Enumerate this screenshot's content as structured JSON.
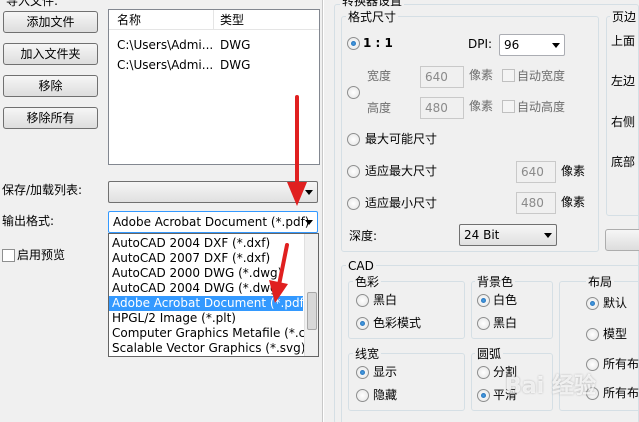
{
  "colors": {
    "accent": "#3399ff",
    "arrow": "#e02020",
    "focus": "#3399ff"
  },
  "left": {
    "import_group_title": "导入文件:",
    "buttons": [
      "添加文件",
      "加入文件夹",
      "移除",
      "移除所有"
    ],
    "file_list": {
      "columns": [
        "名称",
        "类型"
      ],
      "rows": [
        {
          "name": "C:\\Users\\Admi...",
          "type": "DWG"
        },
        {
          "name": "C:\\Users\\Admi...",
          "type": "DWG"
        }
      ]
    },
    "save_load_label": "保存/加载列表:",
    "save_load_value": "",
    "output_format_label": "输出格式:",
    "output_format_value": "Adobe Acrobat Document (*.pdf)",
    "format_options": [
      "AutoCAD 2004 DXF (*.dxf)",
      "AutoCAD 2007 DXF (*.dxf)",
      "AutoCAD 2000 DWG (*.dwg)",
      "AutoCAD 2004 DWG (*.dwg)",
      "Adobe Acrobat Document (*.pdf)",
      "HPGL/2 Image (*.plt)",
      "Computer Graphics Metafile (*.cgm)",
      "Scalable Vector Graphics (*.svg)"
    ],
    "format_selected_index": 4,
    "preview_label": "启用预览",
    "preview_checked": false
  },
  "settings": {
    "title": "转换器设置",
    "size": {
      "title": "格式尺寸",
      "ratio_label": "1 : 1",
      "dpi_label": "DPI:",
      "dpi_value": "96",
      "width_label": "宽度",
      "width_value": "640",
      "pixel_unit": "像素",
      "auto_width_label": "自动宽度",
      "height_label": "高度",
      "height_value": "480",
      "auto_height_label": "自动高度",
      "max_possible_label": "最大可能尺寸",
      "fit_max_label": "适应最大尺寸",
      "fit_max_value": "640",
      "fit_min_label": "适应最小尺寸",
      "fit_min_value": "480",
      "depth_label": "深度:",
      "depth_value": "24 Bit"
    },
    "margin": {
      "title": "页边",
      "top": "上面",
      "left": "左边",
      "right": "右侧",
      "bottom": "底部"
    },
    "cad": {
      "title": "CAD",
      "color": {
        "title": "色彩",
        "options": [
          "黑白",
          "色彩模式"
        ],
        "selected": 1
      },
      "background": {
        "title": "背景色",
        "options": [
          "白色",
          "黑白"
        ],
        "selected": 0
      },
      "layout": {
        "title": "布局",
        "options": [
          "默认",
          "模型",
          "所有布",
          "所有布"
        ],
        "selected": 0
      },
      "lineweight": {
        "title": "线宽",
        "options": [
          "显示",
          "隐藏"
        ],
        "selected": 0
      },
      "arc": {
        "title": "圆弧",
        "options": [
          "分割",
          "平滑"
        ],
        "selected": 1
      }
    }
  },
  "watermark": "Bai 经验"
}
